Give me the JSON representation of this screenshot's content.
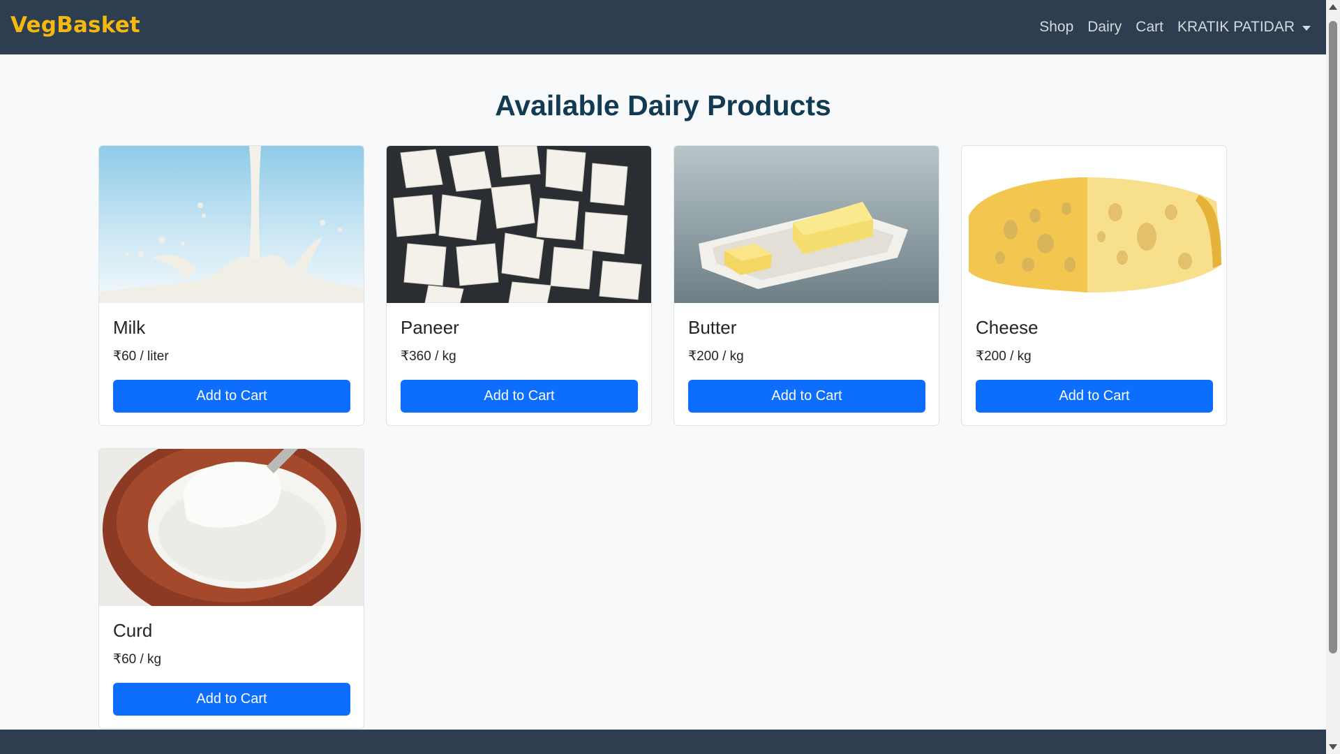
{
  "navbar": {
    "brand": "VegBasket",
    "links": [
      {
        "label": "Shop"
      },
      {
        "label": "Dairy"
      },
      {
        "label": "Cart"
      }
    ],
    "user": "KRATIK PATIDAR"
  },
  "page": {
    "title": "Available Dairy Products"
  },
  "products": [
    {
      "name": "Milk",
      "price": "₹60 / liter",
      "button": "Add to Cart",
      "image": "milk-splash-image"
    },
    {
      "name": "Paneer",
      "price": "₹360 / kg",
      "button": "Add to Cart",
      "image": "paneer-cubes-image"
    },
    {
      "name": "Butter",
      "price": "₹200 / kg",
      "button": "Add to Cart",
      "image": "butter-dish-image"
    },
    {
      "name": "Cheese",
      "price": "₹200 / kg",
      "button": "Add to Cart",
      "image": "cheese-wheel-image"
    },
    {
      "name": "Curd",
      "price": "₹60 / kg",
      "button": "Add to Cart",
      "image": "curd-bowl-image"
    }
  ],
  "colors": {
    "navbar": "#2c3e50",
    "brand": "#f5b80f",
    "title": "#123a52",
    "button": "#0d6efd",
    "page_background": "#f8f9fa"
  }
}
